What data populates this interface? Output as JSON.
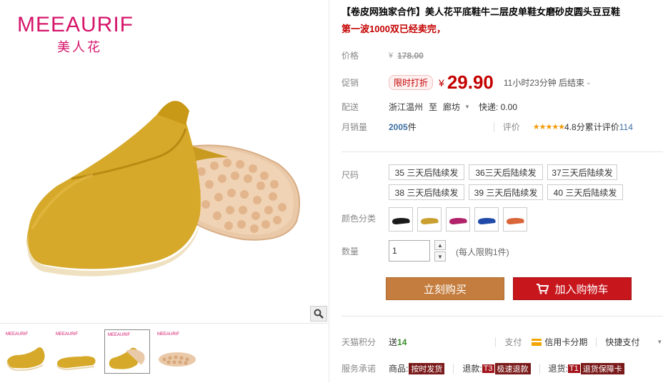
{
  "brand": {
    "name_en": "MEEAURIF",
    "name_cn": "美人花"
  },
  "product": {
    "title": "【卷皮网独家合作】美人花平底鞋牛二层皮单鞋女磨砂皮圆头豆豆鞋",
    "subtitle": "第一波1000双已经卖完，"
  },
  "price": {
    "label": "价格",
    "currency": "¥",
    "original": "178.00",
    "promo_label": "促销",
    "promo_badge": "限时打折",
    "current": "29.90",
    "countdown": "11小时23分钟 后结束"
  },
  "shipping": {
    "label": "配送",
    "from": "浙江温州",
    "to_word": "至",
    "dest": "廊坊",
    "express": "快递: 0.00"
  },
  "sales": {
    "label": "月销量",
    "count": "2005",
    "unit": "件",
    "rating_label": "评价",
    "stars": "★★★★★",
    "score": "4.8分",
    "cumulative_label": "累计评价",
    "cumulative_count": "114"
  },
  "sizes": {
    "label": "尺码",
    "options": [
      "35 三天后陆续发",
      "36三天后陆续发",
      "37三天后陆续发",
      "38 三天后陆续发",
      "39 三天后陆续发",
      "40 三天后陆续发"
    ]
  },
  "colors": {
    "label": "颜色分类",
    "swatches": [
      {
        "name": "black",
        "hex": "#1a1a1a"
      },
      {
        "name": "yellow",
        "hex": "#c9a030"
      },
      {
        "name": "rose",
        "hex": "#b0236a"
      },
      {
        "name": "blue",
        "hex": "#1f4aa8"
      },
      {
        "name": "orange",
        "hex": "#d9653a"
      }
    ]
  },
  "quantity": {
    "label": "数量",
    "value": "1",
    "note": "(每人限购1件)"
  },
  "actions": {
    "buy_now": "立刻购买",
    "add_cart": "加入购物车"
  },
  "points": {
    "label": "天猫积分",
    "send": "送",
    "value": "14",
    "pay_label": "支付",
    "credit": "信用卡分期",
    "quick": "快捷支付"
  },
  "service": {
    "label": "服务承诺",
    "goods_label": "商品:",
    "goods_tag": "按时发货",
    "refund_label": "退款:",
    "refund_num": "T3",
    "refund_tag": "极速退款",
    "return_label": "退货:",
    "return_num": "T1",
    "return_tag": "退货保障卡"
  },
  "colors_ui": {
    "accent_red": "#c40000",
    "buy_bg": "#c47d3e",
    "cart_bg": "#c8161d",
    "brand_pink": "#d6166b"
  }
}
